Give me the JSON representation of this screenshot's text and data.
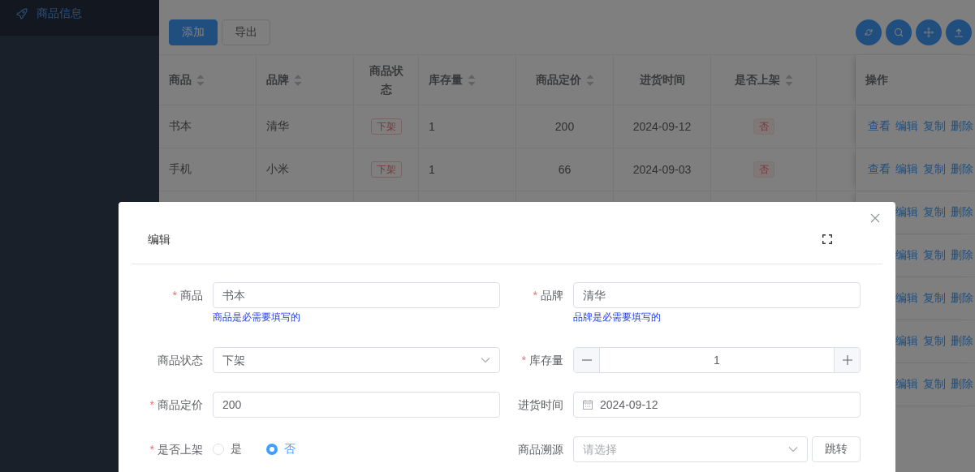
{
  "sidebar": {
    "items": [
      {
        "label": "商品信息",
        "selected": true
      }
    ]
  },
  "toolbar": {
    "buttons": [
      {
        "label": "添加",
        "kind": "primary"
      },
      {
        "label": "导出",
        "kind": "default"
      }
    ]
  },
  "table": {
    "columns": [
      {
        "label": "商品",
        "sortable": true,
        "kind": "text"
      },
      {
        "label": "品牌",
        "sortable": true,
        "kind": "text"
      },
      {
        "label": "商品状态",
        "sortable": false,
        "kind": "tag"
      },
      {
        "label": "库存量",
        "sortable": true,
        "kind": "text"
      },
      {
        "label": "商品定价",
        "sortable": true,
        "kind": "text"
      },
      {
        "label": "进货时间",
        "sortable": false,
        "kind": "text"
      },
      {
        "label": "是否上架",
        "sortable": true,
        "kind": "badge"
      }
    ],
    "actions_column": "操作",
    "rows": [
      {
        "cells": [
          "书本",
          "清华",
          "下架",
          "1",
          "200",
          "2024-09-12",
          "否"
        ],
        "actions": [
          "查看",
          "编辑",
          "复制",
          "删除"
        ]
      },
      {
        "cells": [
          "手机",
          "小米",
          "下架",
          "1",
          "66",
          "2024-09-03",
          "否"
        ],
        "actions": [
          "查看",
          "编辑",
          "复制",
          "删除"
        ]
      },
      {
        "actions": [
          "编辑",
          "复制",
          "删除"
        ]
      },
      {
        "actions": [
          "编辑",
          "复制",
          "删除"
        ]
      },
      {
        "actions": [
          "编辑",
          "复制",
          "删除"
        ]
      },
      {
        "actions": [
          "编辑",
          "复制",
          "删除"
        ]
      },
      {
        "actions": [
          "编辑",
          "复制",
          "删除"
        ]
      }
    ]
  },
  "dialog": {
    "title": "编辑",
    "fields": [
      {
        "kind": "text",
        "label": "商品",
        "required_mark": "*",
        "value": "书本",
        "hint": "商品是必需要填写的"
      },
      {
        "kind": "text",
        "label": "品牌",
        "required_mark": "*",
        "value": "清华",
        "hint": "品牌是必需要填写的"
      },
      {
        "kind": "select",
        "label": "商品状态",
        "value": "下架"
      },
      {
        "kind": "number",
        "label": "库存量",
        "required_mark": "*",
        "value": "1"
      },
      {
        "kind": "text",
        "label": "商品定价",
        "required_mark": "*",
        "value": "200"
      },
      {
        "kind": "date",
        "label": "进货时间",
        "value": "2024-09-12"
      },
      {
        "kind": "radio",
        "label": "是否上架",
        "required_mark": "*",
        "options": [
          {
            "label": "是",
            "selected": false
          },
          {
            "label": "否",
            "selected": true
          }
        ]
      },
      {
        "kind": "select-button",
        "label": "商品溯源",
        "placeholder": "请选择",
        "button": "跳转"
      }
    ]
  }
}
